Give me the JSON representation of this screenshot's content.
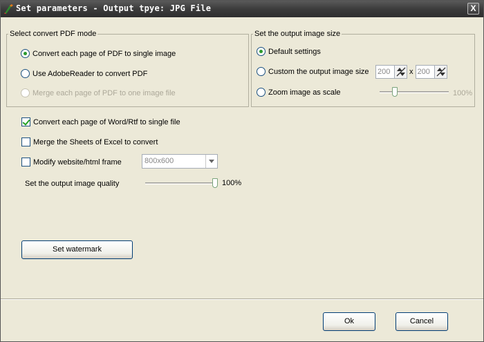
{
  "window": {
    "title": "Set parameters - Output tpye: JPG File",
    "close_glyph": "X"
  },
  "pdf_mode": {
    "legend": "Select convert PDF mode",
    "options": [
      {
        "label": "Convert each page of PDF to single image",
        "selected": true,
        "enabled": true
      },
      {
        "label": "Use AdobeReader to convert PDF",
        "selected": false,
        "enabled": true
      },
      {
        "label": "Merge each page of PDF to one image file",
        "selected": false,
        "enabled": false
      }
    ]
  },
  "image_size": {
    "legend": "Set the output image size",
    "default_label": "Default settings",
    "custom_label": "Custom the output image size",
    "width_value": "200",
    "times_sign": "x",
    "height_value": "200",
    "zoom_label": "Zoom image as scale",
    "zoom_percent_label": "100%",
    "zoom_value": 0.2
  },
  "options": {
    "word_rtf_label": "Convert each page of Word/Rtf to single file",
    "word_rtf_checked": true,
    "excel_label": "Merge the Sheets of Excel to convert",
    "excel_checked": false,
    "website_label": "Modify website/html frame",
    "website_checked": false,
    "frame_size": "800x600"
  },
  "quality": {
    "label": "Set the output image quality",
    "value_label": "100%",
    "value": 1.0
  },
  "buttons": {
    "watermark": "Set watermark",
    "ok": "Ok",
    "cancel": "Cancel"
  },
  "colors": {
    "titlebar": "#3c3c3c",
    "dialog_bg": "#ece9d8",
    "radio_dot": "#2c9a2c"
  }
}
